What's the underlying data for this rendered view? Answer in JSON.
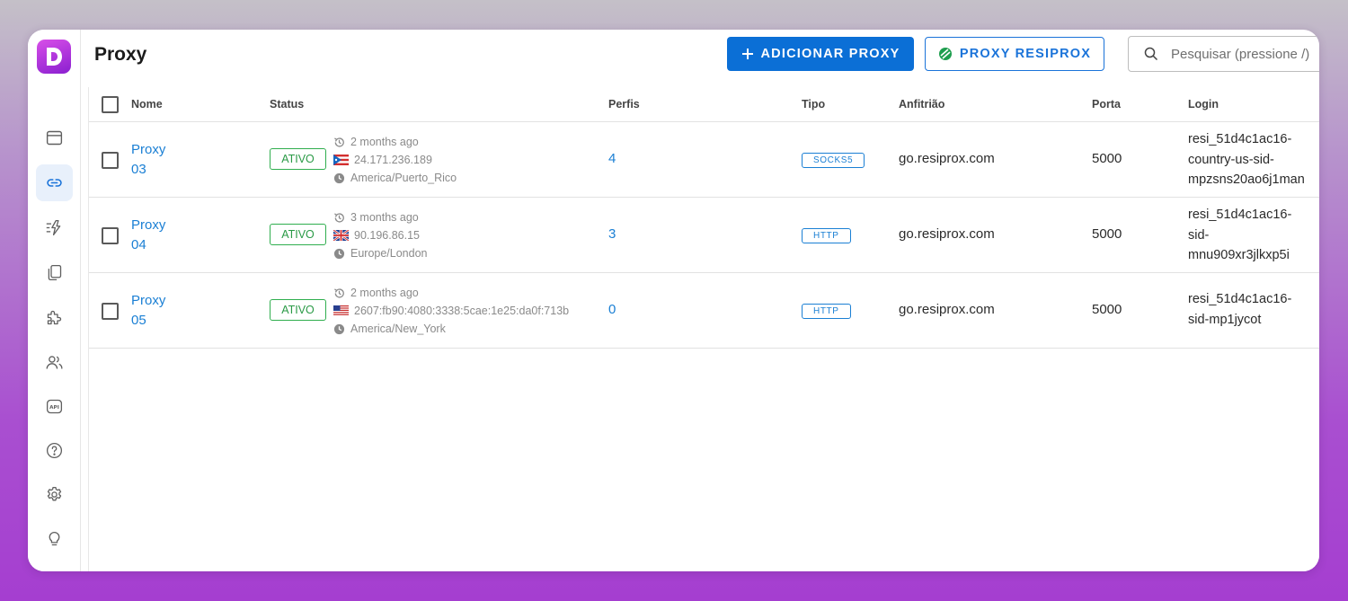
{
  "header": {
    "title": "Proxy",
    "add_button": "ADICIONAR PROXY",
    "resiprox_button": "PROXY RESIPROX",
    "search_placeholder": "Pesquisar (pressione /)"
  },
  "sidebar": {
    "logo": "D",
    "items": [
      {
        "icon": "browser-window-icon",
        "active": false
      },
      {
        "icon": "link-icon",
        "active": true
      },
      {
        "icon": "automation-bolt-icon",
        "active": false
      },
      {
        "icon": "copy-pages-icon",
        "active": false
      },
      {
        "icon": "puzzle-extension-icon",
        "active": false
      },
      {
        "icon": "users-icon",
        "active": false
      },
      {
        "icon": "api-icon",
        "active": false
      },
      {
        "icon": "help-question-icon",
        "active": false
      },
      {
        "icon": "settings-gear-icon",
        "active": false
      },
      {
        "icon": "lightbulb-icon",
        "active": false
      }
    ]
  },
  "table": {
    "columns": [
      "Nome",
      "Status",
      "Perfis",
      "Tipo",
      "Anfitrião",
      "Porta",
      "Login"
    ],
    "rows": [
      {
        "name_line1": "Proxy",
        "name_line2": "03",
        "status": "ATIVO",
        "checked": "2 months ago",
        "ip": "24.171.236.189",
        "flag": "puerto-rico-flag-icon",
        "timezone": "America/Puerto_Rico",
        "profiles": "4",
        "type": "SOCKS5",
        "host": "go.resiprox.com",
        "port": "5000",
        "login": [
          "resi_51d4c1ac16-",
          "country-us-sid-",
          "mpzsns20ao6j1man"
        ]
      },
      {
        "name_line1": "Proxy",
        "name_line2": "04",
        "status": "ATIVO",
        "checked": "3 months ago",
        "ip": "90.196.86.15",
        "flag": "uk-flag-icon",
        "timezone": "Europe/London",
        "profiles": "3",
        "type": "HTTP",
        "host": "go.resiprox.com",
        "port": "5000",
        "login": [
          "resi_51d4c1ac16-",
          "sid-",
          "mnu909xr3jlkxp5i"
        ]
      },
      {
        "name_line1": "Proxy",
        "name_line2": "05",
        "status": "ATIVO",
        "checked": "2 months ago",
        "ip": "2607:fb90:4080:3338:5cae:1e25:da0f:713b",
        "flag": "us-flag-icon",
        "timezone": "America/New_York",
        "profiles": "0",
        "type": "HTTP",
        "host": "go.resiprox.com",
        "port": "5000",
        "login": [
          "resi_51d4c1ac16-",
          "sid-mp1jycot"
        ]
      }
    ]
  },
  "colors": {
    "primary": "#0b6fd6",
    "link": "#1a7fd4",
    "status_green": "#2fae4e",
    "brand_purple": "#a53ed0"
  }
}
